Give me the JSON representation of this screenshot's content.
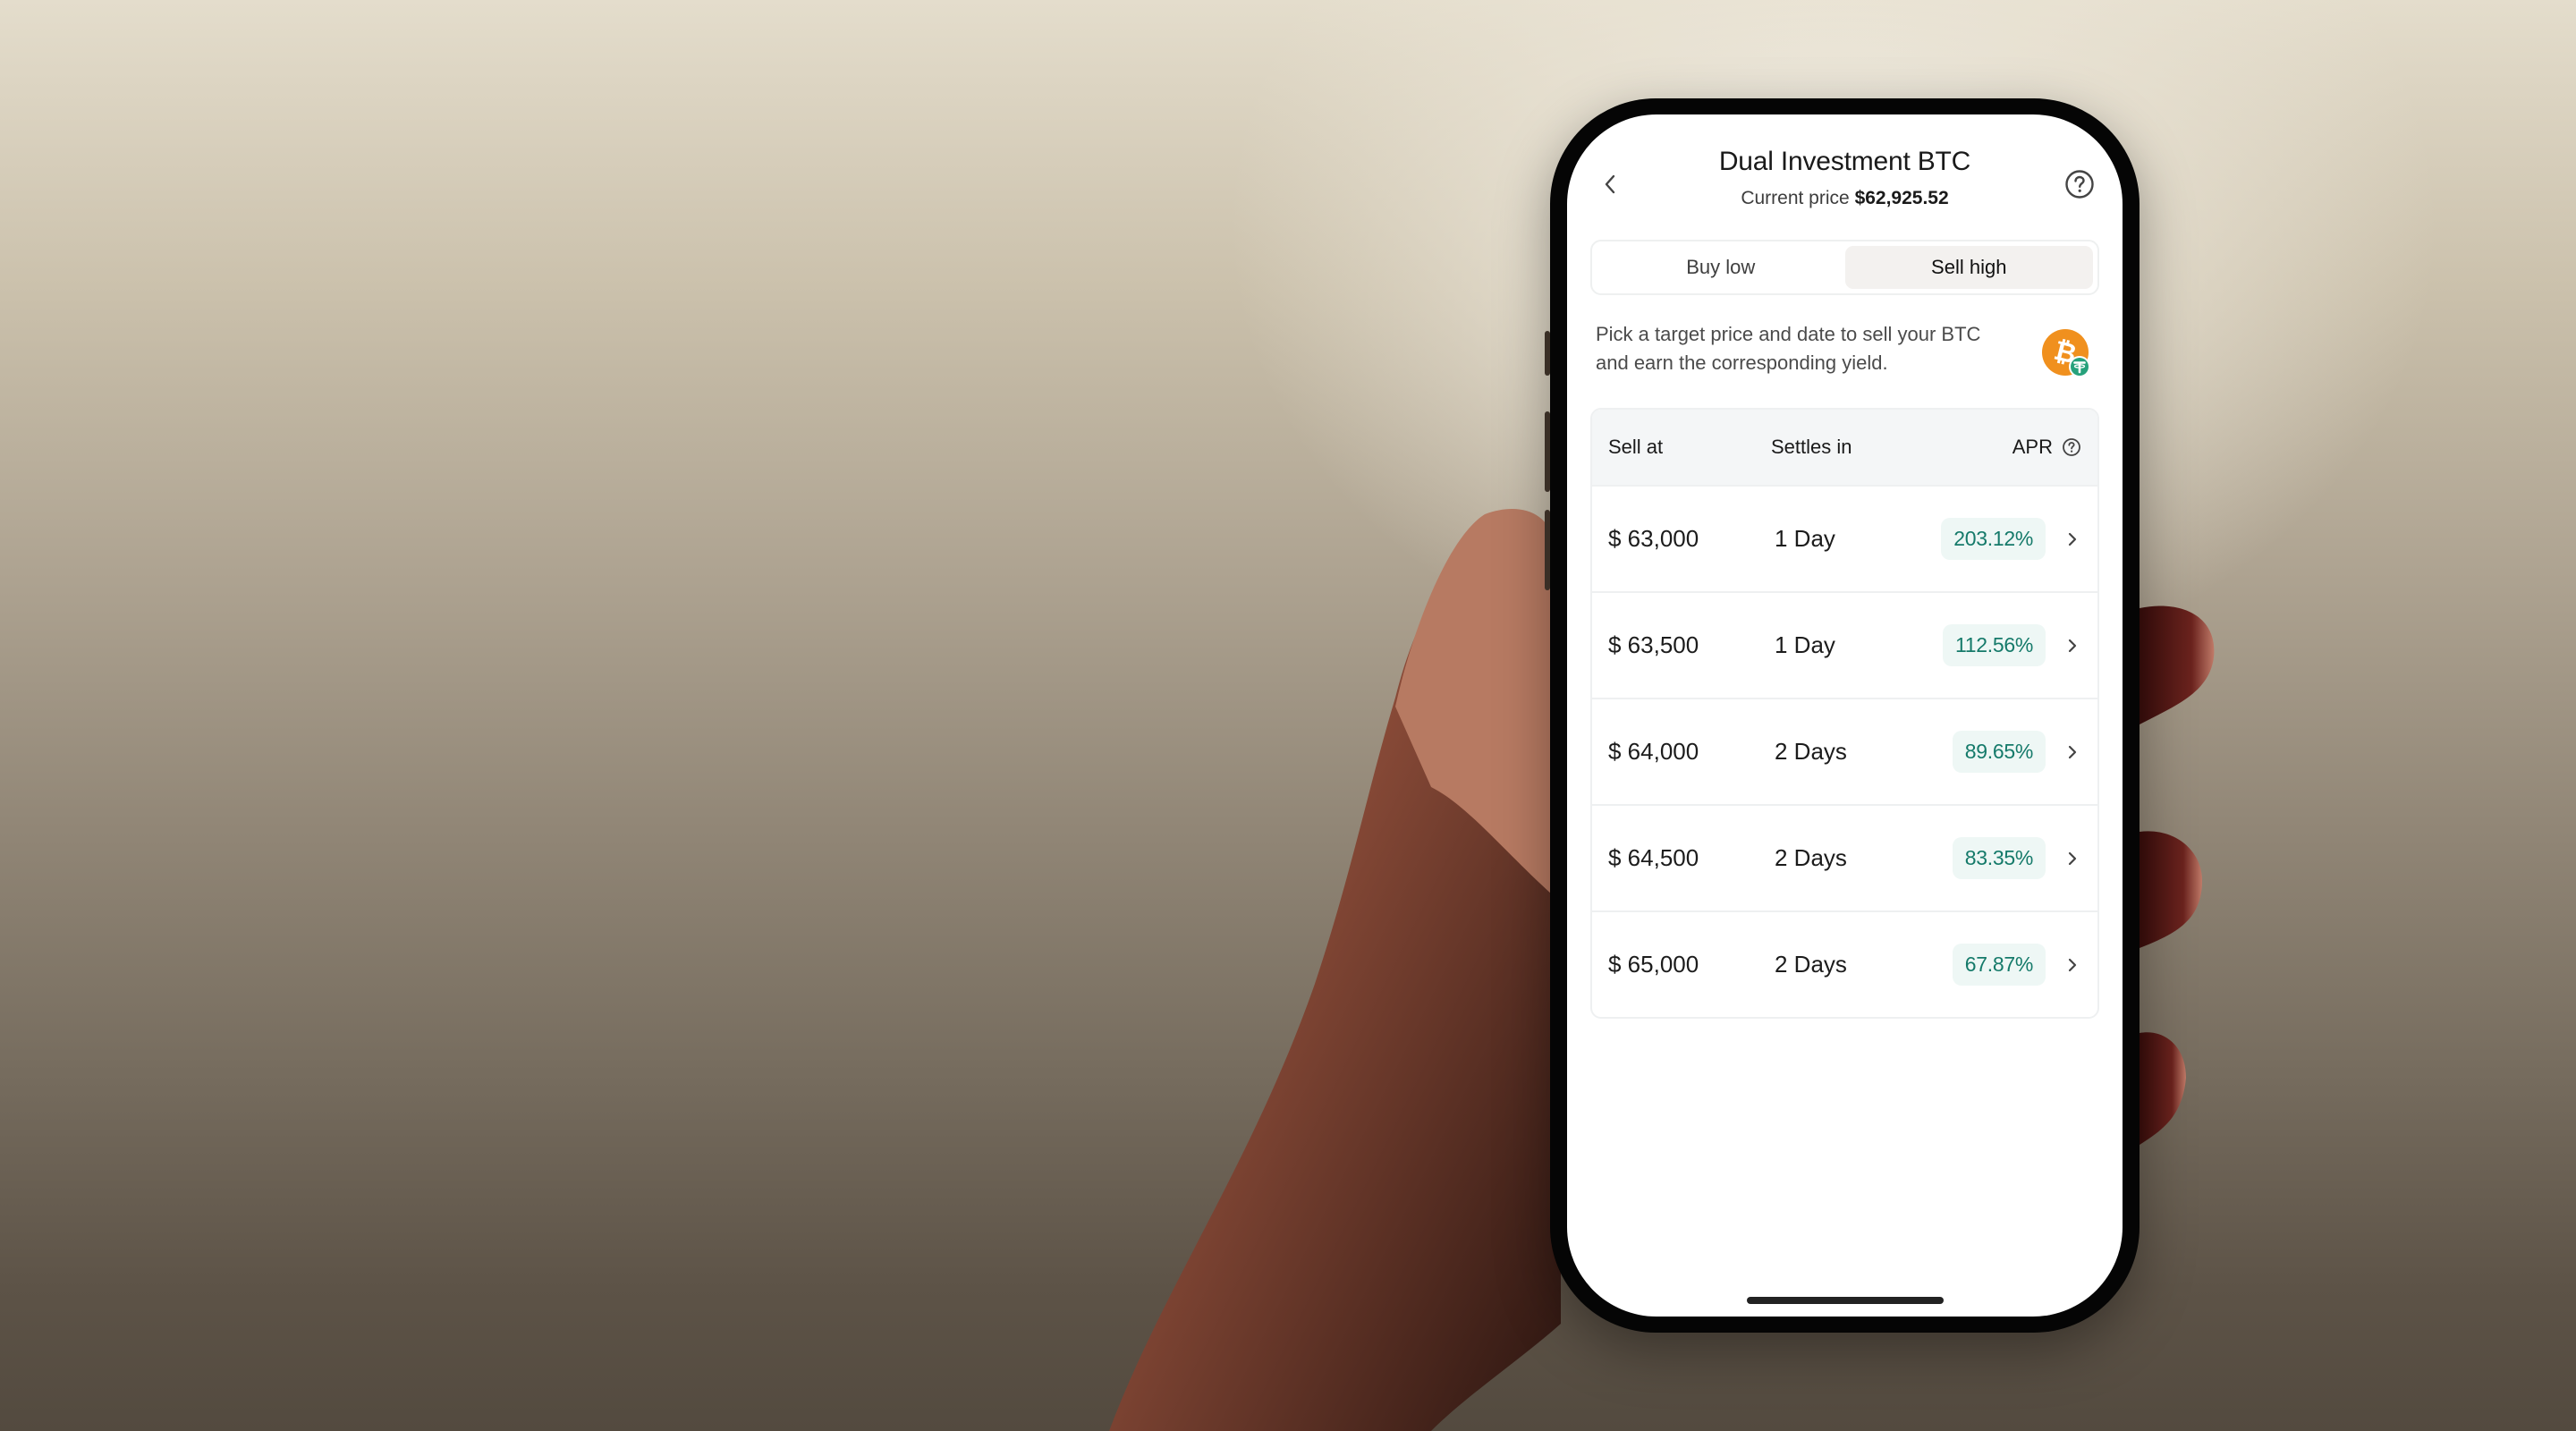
{
  "header": {
    "title": "Dual Investment BTC",
    "current_price_label": "Current price",
    "current_price_value": "$62,925.52",
    "back_icon": "chevron-left-icon",
    "help_icon": "question-circle-icon"
  },
  "tabs": [
    {
      "label": "Buy low",
      "active": false
    },
    {
      "label": "Sell high",
      "active": true
    }
  ],
  "description": "Pick a target price and date to sell your BTC and earn the corresponding yield.",
  "coin_icon": "btc-usdt-pair-icon",
  "table": {
    "headers": {
      "sell_at": "Sell at",
      "settles_in": "Settles in",
      "apr": "APR",
      "apr_icon": "question-circle-icon"
    },
    "rows": [
      {
        "sell_at": "$ 63,000",
        "settles_in": "1 Day",
        "apr": "203.12%"
      },
      {
        "sell_at": "$ 63,500",
        "settles_in": "1 Day",
        "apr": "112.56%"
      },
      {
        "sell_at": "$ 64,000",
        "settles_in": "2 Days",
        "apr": "89.65%"
      },
      {
        "sell_at": "$ 64,500",
        "settles_in": "2 Days",
        "apr": "83.35%"
      },
      {
        "sell_at": "$ 65,000",
        "settles_in": "2 Days",
        "apr": "67.87%"
      }
    ]
  },
  "colors": {
    "apr_text": "#157a6a",
    "apr_bg": "#eef7f5",
    "btc_orange": "#f0901e",
    "usdt_green": "#26a17b",
    "active_tab_bg": "#f3f1ef"
  }
}
